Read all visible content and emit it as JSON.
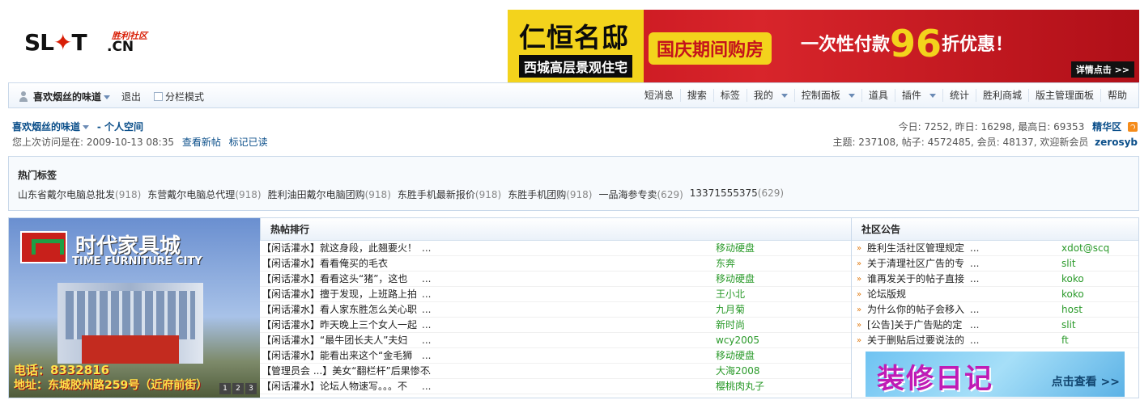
{
  "logo": {
    "brand_prefix": "SL",
    "brand_mid": "T",
    "brand_suffix": ".CN",
    "chinese_name": "胜利社区"
  },
  "banner": {
    "title": "仁恒名邸",
    "subtitle": "西城高层景观住宅",
    "slogan1": "国庆期间购房",
    "slogan2_prefix": "一次性付款",
    "slogan2_num": "96",
    "slogan2_suffix": "折优惠！",
    "detail_button": "详情点击 >>"
  },
  "userbar": {
    "username": "喜欢烟丝的味道",
    "logout": "退出",
    "split_mode": "分栏模式"
  },
  "nav": {
    "items": [
      "短消息",
      "搜索",
      "标签",
      "我的",
      "控制面板",
      "道具",
      "插件",
      "统计",
      "胜利商城",
      "版主管理面板",
      "帮助"
    ]
  },
  "userinfo": {
    "username": "喜欢烟丝的味道",
    "space": "- 个人空间",
    "last_visit_label": "您上次访问是在: 2009-10-13 08:35",
    "new_posts": "查看新帖",
    "mark_read": "标记已读",
    "stats_today": "今日: 7252, 昨日: 16298, 最高日: 69353",
    "digest": "精华区",
    "stats_totals": "主题: 237108, 帖子: 4572485, 会员: 48137, 欢迎新会员",
    "newest_member": "zerosyb"
  },
  "hottags": {
    "title": "热门标签",
    "tags": [
      {
        "name": "山东省戴尔电脑总批发",
        "count": "(918)"
      },
      {
        "name": "东营戴尔电脑总代理",
        "count": "(918)"
      },
      {
        "name": "胜利油田戴尔电脑团购",
        "count": "(918)"
      },
      {
        "name": "东胜手机最新报价",
        "count": "(918)"
      },
      {
        "name": "东胜手机团购",
        "count": "(918)"
      },
      {
        "name": "一品海参专卖",
        "count": "(629)"
      },
      {
        "name": "13371555375",
        "count": "(629)"
      }
    ]
  },
  "ad_left": {
    "brand": "时代家具城",
    "brand_en": "TIME FURNITURE CITY",
    "tel": "电话：8332816",
    "address": "地址：东城胶州路259号（近府前街）",
    "pages": [
      "1",
      "2",
      "3"
    ]
  },
  "hotposts": {
    "title": "热帖排行",
    "posts": [
      {
        "title": "【闲话灌水】就这身段，此翘要火！",
        "more": "...",
        "author": "移动硬盘"
      },
      {
        "title": "【闲话灌水】看看俺买的毛衣",
        "more": "",
        "author": "东奔"
      },
      {
        "title": "【闲话灌水】看看这头“猪”，这也",
        "more": "...",
        "author": "移动硬盘"
      },
      {
        "title": "【闲话灌水】擅于发现，上班路上拍",
        "more": "...",
        "author": "王小北"
      },
      {
        "title": "【闲话灌水】看人家东胜怎么关心职",
        "more": "...",
        "author": "九月菊"
      },
      {
        "title": "【闲话灌水】昨天晚上三个女人一起",
        "more": "...",
        "author": "新时尚"
      },
      {
        "title": "【闲话灌水】“最牛团长夫人”夫妇",
        "more": "...",
        "author": "wcy2005"
      },
      {
        "title": "【闲话灌水】能看出来这个“金毛狮",
        "more": "...",
        "author": "移动硬盘"
      },
      {
        "title": "【管理员会 ...】美女“翻栏杆”后果惨不",
        "more": "...",
        "author": "大海2008"
      },
      {
        "title": "【闲话灌水】论坛人物速写。。。不",
        "more": "...",
        "author": "樱桃肉丸子"
      }
    ]
  },
  "notice": {
    "title": "社区公告",
    "items": [
      {
        "title": "胜利生活社区管理规定",
        "more": "...",
        "author": "xdot@scq"
      },
      {
        "title": "关于清理社区广告的专",
        "more": "...",
        "author": "slit"
      },
      {
        "title": "谁再发关于的帖子直接",
        "more": "...",
        "author": "koko"
      },
      {
        "title": "论坛版规",
        "more": "",
        "author": "koko"
      },
      {
        "title": "为什么你的帖子会移入",
        "more": "...",
        "author": "host"
      },
      {
        "title": "[公告]关于广告贴的定",
        "more": "...",
        "author": "slit"
      },
      {
        "title": "关于删贴后过要说法的",
        "more": "...",
        "author": "ft"
      }
    ]
  },
  "ad_small": {
    "text": "装修日记",
    "cta": "点击查看 >>"
  }
}
